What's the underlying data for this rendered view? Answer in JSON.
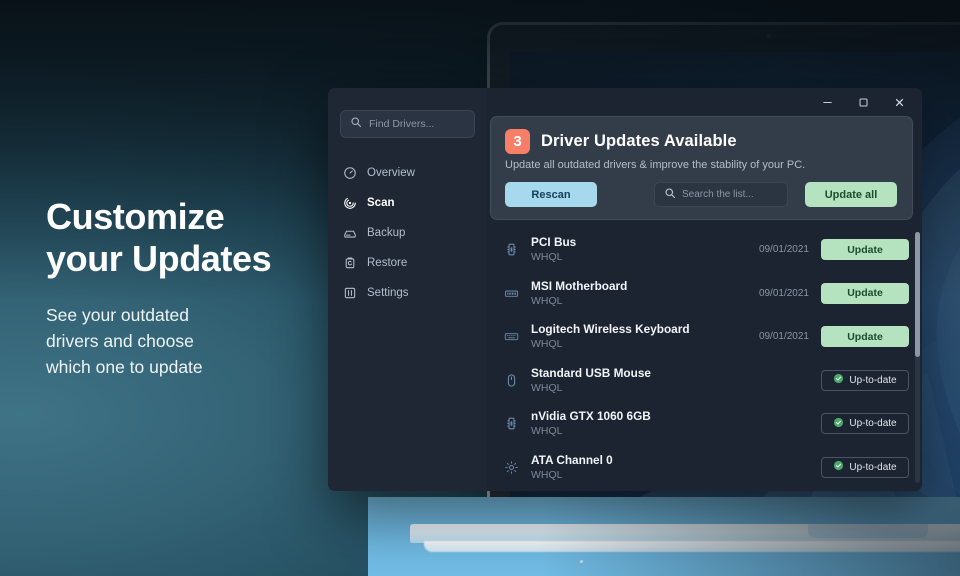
{
  "marketing": {
    "headline_line1": "Customize",
    "headline_line2": "your Updates",
    "subtext_line1": "See your outdated",
    "subtext_line2": "drivers and choose",
    "subtext_line3": "which one to update"
  },
  "window": {
    "controls": {
      "minimize": "–",
      "maximize": "□",
      "close": "×"
    }
  },
  "sidebar": {
    "search": {
      "placeholder": "Find Drivers..."
    },
    "items": [
      {
        "label": "Overview",
        "icon": "gauge-icon",
        "active": false
      },
      {
        "label": "Scan",
        "icon": "scan-target-icon",
        "active": true
      },
      {
        "label": "Backup",
        "icon": "backup-drive-icon",
        "active": false
      },
      {
        "label": "Restore",
        "icon": "restore-clipboard-icon",
        "active": false
      },
      {
        "label": "Settings",
        "icon": "settings-sliders-icon",
        "active": false
      }
    ]
  },
  "hero": {
    "count": "3",
    "title": "Driver Updates Available",
    "subtitle": "Update all outdated drivers & improve the stability of your PC.",
    "rescan_label": "Rescan",
    "search_placeholder": "Search the list...",
    "update_all_label": "Update all"
  },
  "list": {
    "rows": [
      {
        "name": "PCI Bus",
        "sub": "WHQL",
        "date": "09/01/2021",
        "action": "Update",
        "state": "outdated",
        "icon": "chip-icon"
      },
      {
        "name": "MSI Motherboard",
        "sub": "WHQL",
        "date": "09/01/2021",
        "action": "Update",
        "state": "outdated",
        "icon": "memory-stick-icon"
      },
      {
        "name": "Logitech Wireless Keyboard",
        "sub": "WHQL",
        "date": "09/01/2021",
        "action": "Update",
        "state": "outdated",
        "icon": "keyboard-icon"
      },
      {
        "name": "Standard USB Mouse",
        "sub": "WHQL",
        "date": "",
        "action": "Up-to-date",
        "state": "uptodate",
        "icon": "mouse-icon"
      },
      {
        "name": "nVidia GTX 1060 6GB",
        "sub": "WHQL",
        "date": "",
        "action": "Up-to-date",
        "state": "uptodate",
        "icon": "chip-icon"
      },
      {
        "name": "ATA Channel 0",
        "sub": "WHQL",
        "date": "",
        "action": "Up-to-date",
        "state": "uptodate",
        "icon": "gear-icon"
      }
    ]
  },
  "colors": {
    "badge_orange": "#f87f67",
    "rescan_blue": "#a6d8ee",
    "update_green": "#b5e3bf",
    "active_indicator": "#bce5cd",
    "window_bg": "#1c2431",
    "sidebar_bg": "#1f2735",
    "hero_bg": "#333c49"
  }
}
